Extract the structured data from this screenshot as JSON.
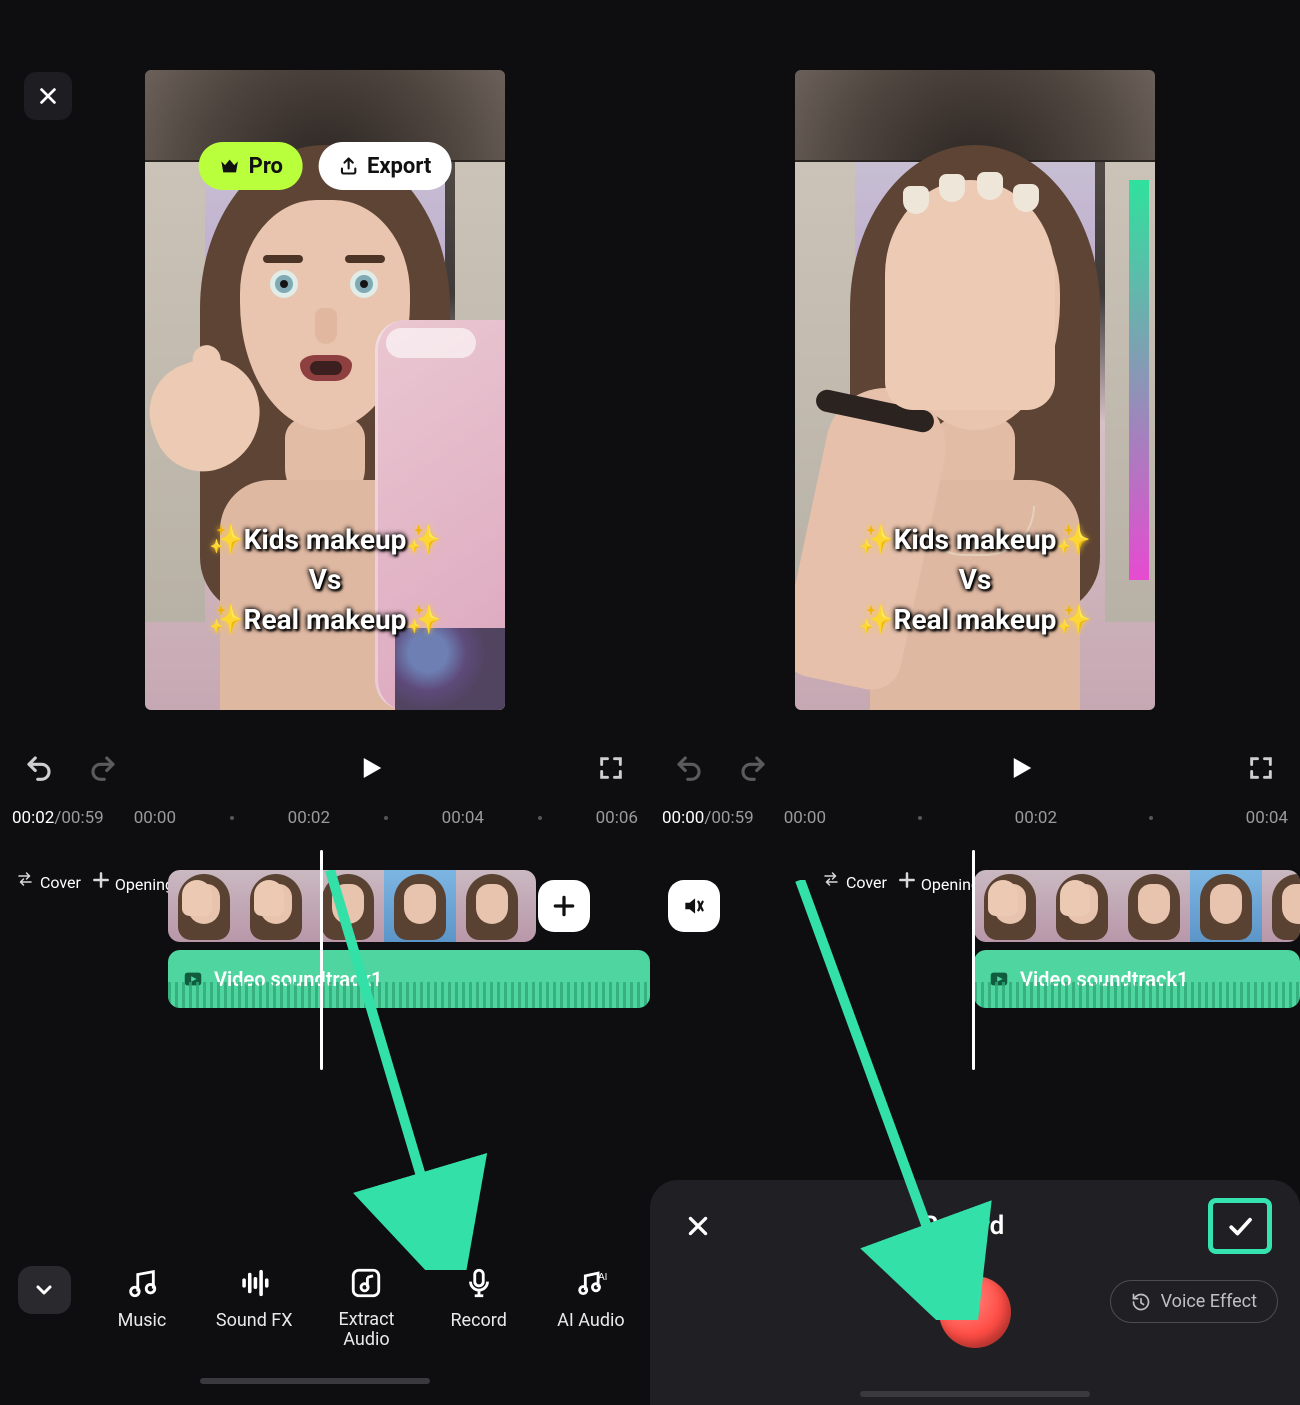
{
  "left": {
    "close_icon": "close",
    "pro_label": "Pro",
    "export_label": "Export",
    "preview": {
      "caption_line1_pre": "✨",
      "caption_line1_text": "Kids makeup",
      "caption_line1_post": "✨",
      "caption_line2": "Vs",
      "caption_line3_pre": "✨",
      "caption_line3_text": "Real makeup",
      "caption_line3_post": "✨"
    },
    "controls": {
      "undo": "undo",
      "redo": "redo",
      "play": "play",
      "fullscreen": "fullscreen"
    },
    "time": {
      "current": "00:02",
      "sep": "/",
      "total": "00:59"
    },
    "ruler": {
      "t0": "00:00",
      "t1": "00:02",
      "t2": "00:04",
      "t3": "00:06"
    },
    "timeline": {
      "cover_label": "Cover",
      "opening_label": "Opening",
      "audio_label": "Video soundtrack1",
      "add": "+",
      "mute": "mute"
    },
    "toolbar": {
      "music": "Music",
      "soundfx": "Sound FX",
      "extract": "Extract Audio",
      "record": "Record",
      "aiaudio": "AI Audio"
    }
  },
  "right": {
    "preview": {
      "caption_line1_pre": "✨",
      "caption_line1_text": "Kids makeup",
      "caption_line1_post": "✨",
      "caption_line2": "Vs",
      "caption_line3_pre": "✨",
      "caption_line3_text": "Real makeup",
      "caption_line3_post": "✨"
    },
    "controls": {
      "undo": "undo",
      "redo": "redo",
      "play": "play",
      "fullscreen": "fullscreen"
    },
    "time": {
      "current": "00:00",
      "sep": "/",
      "total": "00:59"
    },
    "ruler": {
      "t0": "00:00",
      "t1": "00:02",
      "t2": "00:04"
    },
    "timeline": {
      "cover_label": "Cover",
      "opening_label": "Opening",
      "audio_label": "Video soundtrack1"
    },
    "record_sheet": {
      "title": "Record",
      "voice_effect": "Voice Effect"
    }
  }
}
